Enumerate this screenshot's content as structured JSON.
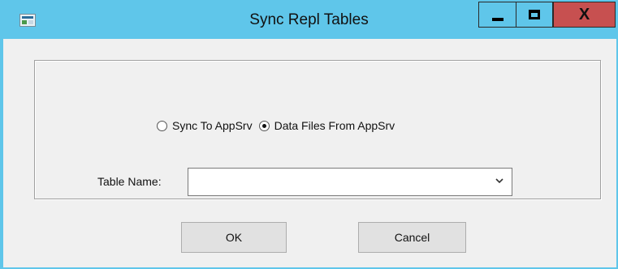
{
  "window": {
    "title": "Sync Repl Tables",
    "controls": {
      "minimize": "minimize",
      "maximize": "maximize",
      "close_label": "X"
    }
  },
  "mode": {
    "options": [
      {
        "label": "Sync To AppSrv",
        "selected": false
      },
      {
        "label": "Data Files From AppSrv",
        "selected": true
      }
    ]
  },
  "table": {
    "label": "Table Name:",
    "value": ""
  },
  "buttons": {
    "ok_label": "OK",
    "cancel_label": "Cancel"
  },
  "colors": {
    "titlebar": "#5fc6ea",
    "close_button": "#c75050",
    "client": "#f0f0f0"
  }
}
